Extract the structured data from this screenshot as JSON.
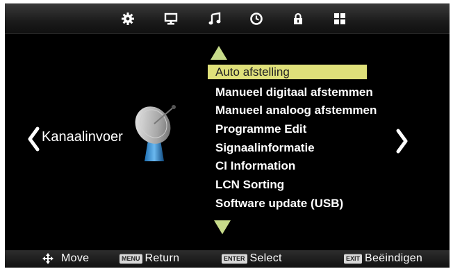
{
  "top_icons": [
    "settings-gear-icon",
    "monitor-icon",
    "music-note-icon",
    "clock-icon",
    "lock-icon",
    "grid-apps-icon"
  ],
  "category": {
    "label": "Kanaalinvoer",
    "icon": "satellite-dish-icon"
  },
  "menu": {
    "selected_index": 0,
    "items": [
      "Auto afstelling",
      "Manueel digitaal afstemmen",
      "Manueel analoog afstemmen",
      "Programme Edit",
      "Signaalinformatie",
      "CI Information",
      "LCN Sorting",
      "Software update (USB)"
    ]
  },
  "footer": {
    "move": {
      "icon": "move-arrows-icon",
      "label": "Move"
    },
    "return": {
      "key": "MENU",
      "label": "Return"
    },
    "select": {
      "key": "ENTER",
      "label": "Select"
    },
    "exit": {
      "key": "EXIT",
      "label": "Beëindigen"
    }
  },
  "colors": {
    "selection": "#dfe07a",
    "scroll_arrows": "#c7db8a",
    "background": "#000000",
    "text": "#ffffff"
  }
}
